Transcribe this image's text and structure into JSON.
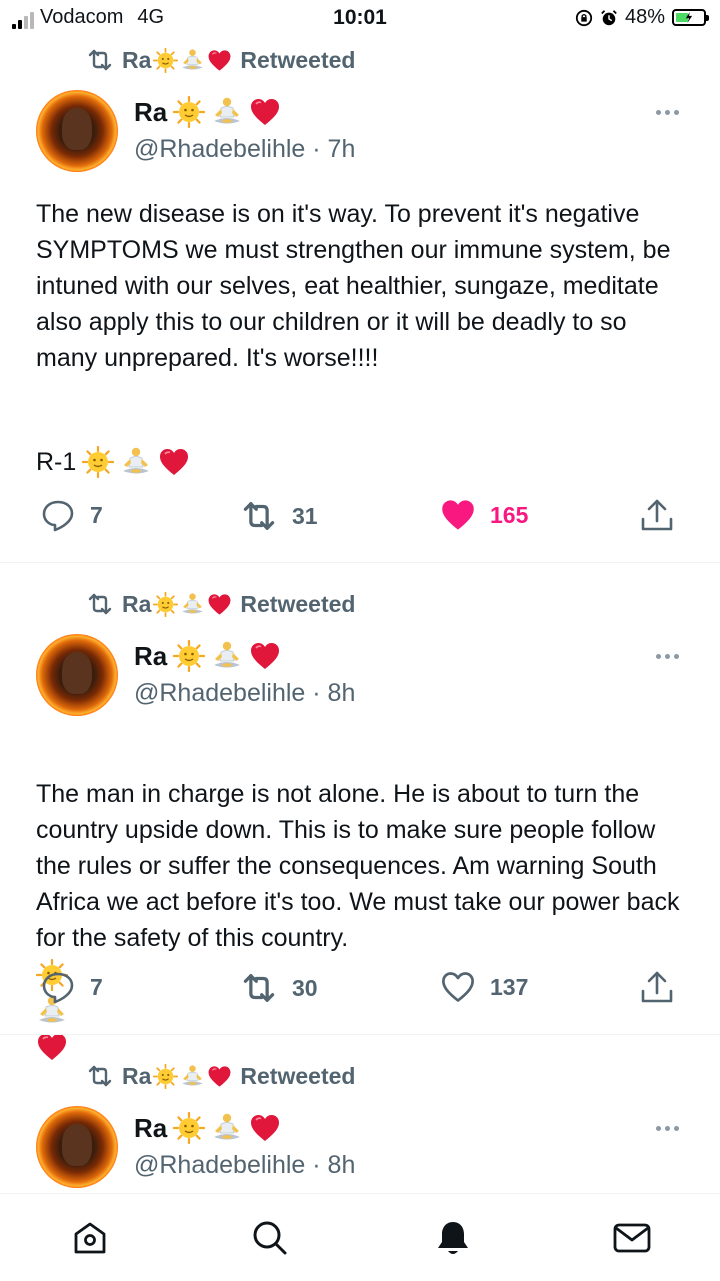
{
  "status_bar": {
    "carrier": "Vodacom",
    "network": "4G",
    "time": "10:01",
    "battery": "48%",
    "battery_level": 0.48,
    "icons": [
      "signal-icon",
      "orientation-lock-icon",
      "alarm-icon",
      "battery-icon"
    ]
  },
  "tweets": [
    {
      "retweeted_by": "Ra",
      "retweet_label": "Retweeted",
      "name": "Ra",
      "handle": "@Rhadebelihle",
      "time": "7h",
      "text": "The new disease is on it's way. To prevent it's negative SYMPTOMS we must strengthen our immune system, be intuned with our selves, eat healthier, sungaze, meditate also apply this to our children or it will be deadly to so many unprepared. It's worse!!!!",
      "signature": "R-1",
      "replies": "7",
      "retweets": "31",
      "likes": "165",
      "liked": true
    },
    {
      "retweeted_by": "Ra",
      "retweet_label": "Retweeted",
      "name": "Ra",
      "handle": "@Rhadebelihle",
      "time": "8h",
      "text": "The man in charge is not alone. He is about to turn the country upside down. This is to make sure people follow the rules or suffer the consequences. Am warning South Africa we act before it's too. We must take our power back for the safety of this country.",
      "replies": "7",
      "retweets": "30",
      "likes": "137",
      "liked": false
    },
    {
      "retweeted_by": "Ra",
      "retweet_label": "Retweeted",
      "name": "Ra",
      "handle": "@Rhadebelihle",
      "time": "8h"
    }
  ],
  "name_emojis": [
    "sun-with-face-emoji",
    "person-in-lotus-position-emoji",
    "red-heart-emoji"
  ],
  "tab_bar": [
    "home-icon",
    "search-icon",
    "notifications-bell-icon",
    "messages-envelope-icon"
  ],
  "colors": {
    "like_active": "#f91880",
    "secondary_text": "#536471"
  }
}
